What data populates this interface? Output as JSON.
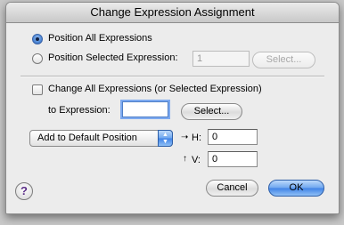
{
  "window": {
    "title": "Change Expression Assignment"
  },
  "position_group": {
    "all_label": "Position All Expressions",
    "selected_label": "Position Selected Expression:",
    "selected_value": "1",
    "select_button": "Select...",
    "selected_option": "all"
  },
  "change_group": {
    "checkbox_label": "Change All Expressions (or Selected Expression)",
    "checked": false,
    "to_label": "to Expression:",
    "to_value": "",
    "select_button": "Select..."
  },
  "offset": {
    "popup_value": "Add to Default Position",
    "h_icon": "right-arrow-icon",
    "h_label": "H:",
    "h_value": "0",
    "v_icon": "up-arrow-icon",
    "v_label": "V:",
    "v_value": "0"
  },
  "buttons": {
    "cancel": "Cancel",
    "ok": "OK",
    "help": "?"
  },
  "colors": {
    "accent": "#3f82e6",
    "background": "#ececec"
  }
}
